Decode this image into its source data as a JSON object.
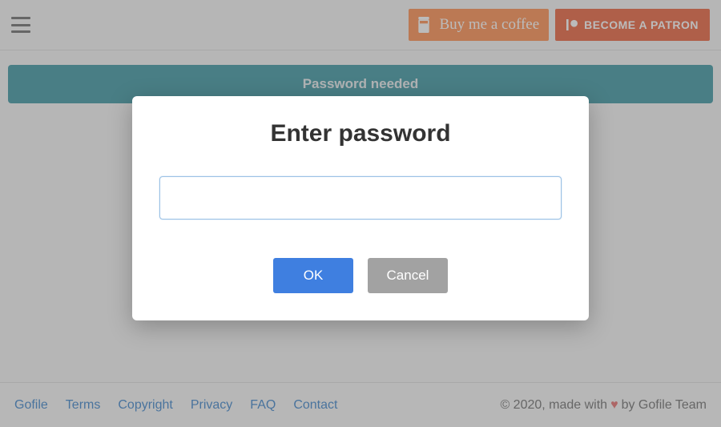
{
  "header": {
    "coffee_label": "Buy me a coffee",
    "patron_label": "BECOME A PATRON"
  },
  "banner": {
    "text": "Password needed"
  },
  "modal": {
    "title": "Enter password",
    "ok_label": "OK",
    "cancel_label": "Cancel",
    "input_value": ""
  },
  "footer": {
    "links": {
      "gofile": "Gofile",
      "terms": "Terms",
      "copyright": "Copyright",
      "privacy": "Privacy",
      "faq": "FAQ",
      "contact": "Contact"
    },
    "credit_prefix": "© 2020, made with",
    "credit_heart": "♥",
    "credit_suffix": "by Gofile Team"
  }
}
